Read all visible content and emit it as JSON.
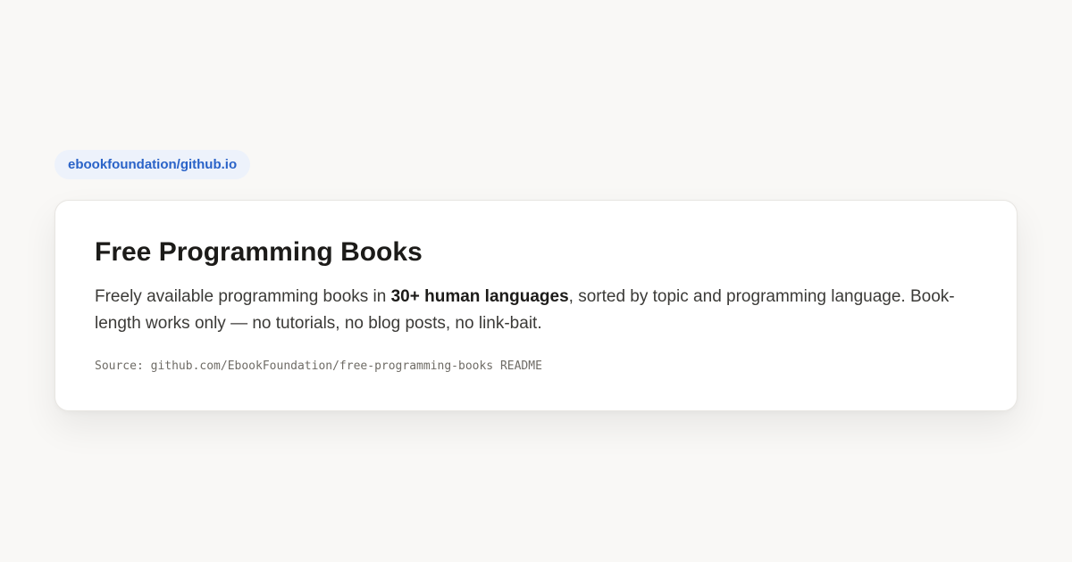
{
  "repo_pill": {
    "label": "ebookfoundation/github.io"
  },
  "card": {
    "title": "Free Programming Books",
    "description": {
      "before": "Freely available programming books in ",
      "emphasis": "30+ human languages",
      "after": ", sorted by topic and programming language. Book-length works only — no tutorials, no blog posts, no link-bait."
    },
    "source": "Source: github.com/EbookFoundation/free-programming-books README"
  },
  "colors": {
    "background": "#f9f8f6",
    "pill_background": "#edf2fb",
    "pill_text": "#2a63c8",
    "card_background": "#ffffff",
    "title_text": "#1c1b19",
    "body_text": "#3b3a37",
    "source_text": "#6f6c66"
  }
}
